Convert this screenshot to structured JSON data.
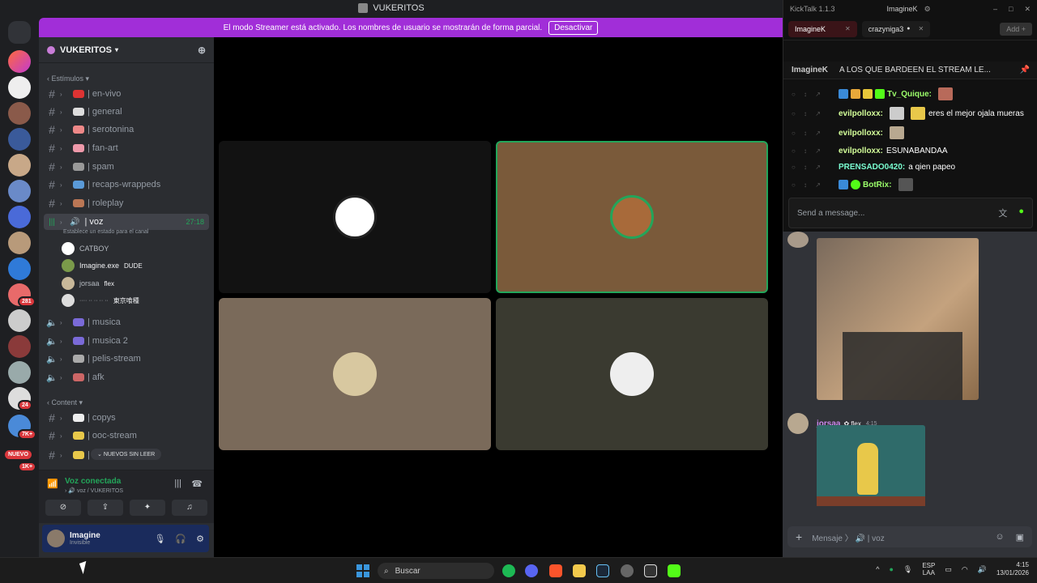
{
  "window": {
    "title": "VUKERITOS"
  },
  "banner": {
    "text": "El modo Streamer está activado. Los nombres de usuario se mostrarán de forma parcial.",
    "button": "Desactivar"
  },
  "server_rail": {
    "badges": [
      "281",
      "24",
      "7K+",
      "1K+"
    ],
    "new_label": "NUEVO"
  },
  "sidebar": {
    "guild_name": "VUKERITOS",
    "category1": "Estímulos",
    "text_channels": [
      {
        "name": "| en-vivo"
      },
      {
        "name": "| general"
      },
      {
        "name": "| serotonina"
      },
      {
        "name": "| fan-art"
      },
      {
        "name": "| spam"
      },
      {
        "name": "| recaps-wrappeds"
      },
      {
        "name": "| roleplay"
      }
    ],
    "voice_active": {
      "name": "| voz",
      "time": "27:18",
      "status_hint": "Establece un estado para el canal"
    },
    "voice_users": [
      {
        "name": "CATBOY",
        "tag": ""
      },
      {
        "name": "Imagine.exe",
        "tag": "DUDE"
      },
      {
        "name": "jorsaa",
        "tag": "flex"
      },
      {
        "name": "···· ·· ·· ·· ··",
        "tag": "東京喰種"
      }
    ],
    "voice_channels": [
      {
        "name": "| musica"
      },
      {
        "name": "| musica 2"
      },
      {
        "name": "| pelis-stream"
      },
      {
        "name": "| afk"
      }
    ],
    "category2": "Content",
    "content_channels": [
      {
        "name": "| copys"
      },
      {
        "name": "| ooc-stream"
      },
      {
        "name": "|"
      }
    ],
    "new_unread": "NUEVOS SIN LEER"
  },
  "voice_panel": {
    "title": "Voz conectada",
    "subtitle": "voz / VUKERITOS"
  },
  "user_panel": {
    "name": "Imagine",
    "status": "Invisible"
  },
  "kicktalk": {
    "app": "KickTalk 1.1.3",
    "user": "ImagineK",
    "tabs": [
      "ImagineK",
      "crazyniga3"
    ],
    "add": "Add",
    "pinned_user": "ImagineK",
    "pinned_text": "A LOS QUE BARDEEN EL STREAM LE...",
    "messages": [
      {
        "user": "Tv_Quique:",
        "text": "",
        "color": "#9cff6b"
      },
      {
        "user": "evilpolloxx:",
        "text": "eres el mejor ojala mueras",
        "color": "#d4ff9a"
      },
      {
        "user": "evilpolloxx:",
        "text": "",
        "color": "#d4ff9a"
      },
      {
        "user": "evilpolloxx:",
        "text": "ESUNABANDAA",
        "color": "#d4ff9a"
      },
      {
        "user": "PRENSADO0420:",
        "text": "a qien papeo",
        "color": "#7affd1"
      },
      {
        "user": "BotRix:",
        "text": "",
        "color": "#9cff6b"
      }
    ],
    "input_placeholder": "Send a message..."
  },
  "discord_chat": {
    "msg_user": "jorsaa",
    "msg_tag": "flex",
    "msg_time": "4:15",
    "composer_placeholder": "Mensaje 〉 🔊 | voz"
  },
  "taskbar": {
    "search": "Buscar",
    "lang1": "ESP",
    "lang2": "LAA",
    "time": "4:15",
    "date": "13/01/2026"
  }
}
